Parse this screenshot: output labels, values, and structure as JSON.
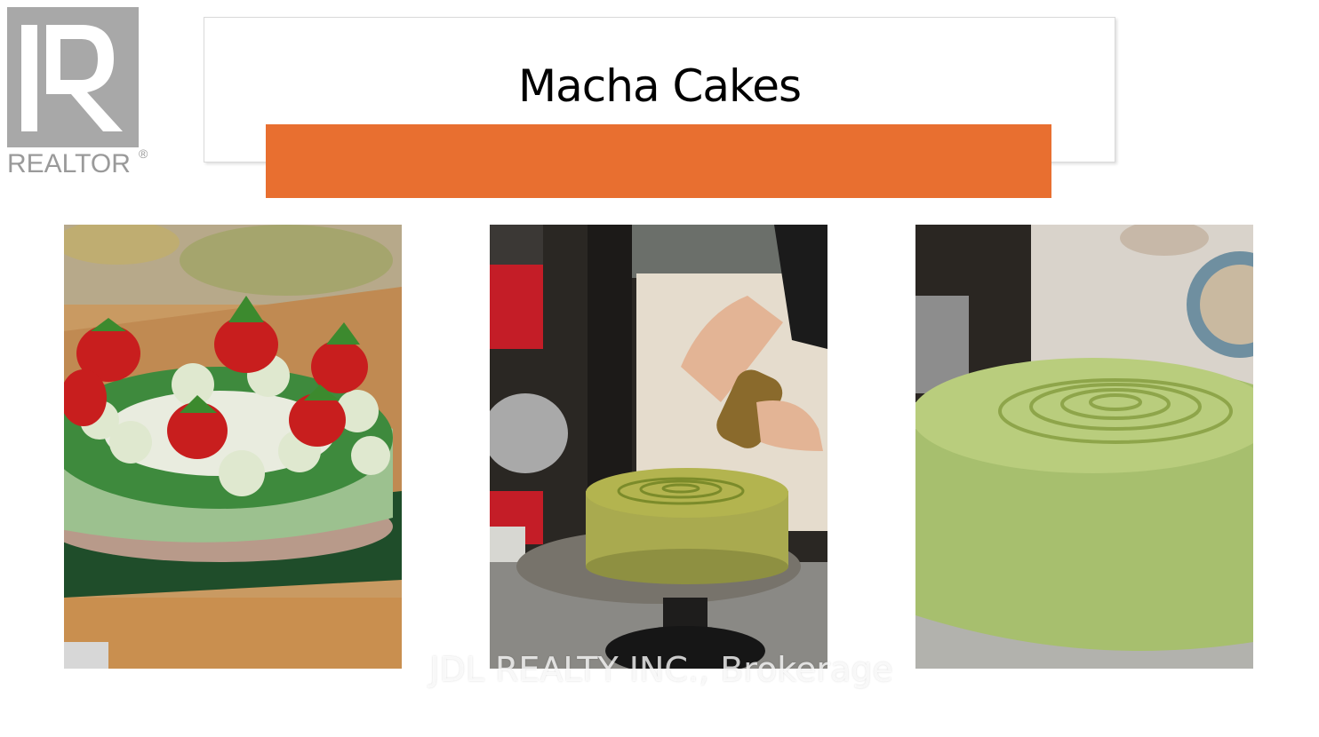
{
  "logo": {
    "text": "REALTOR",
    "mark": "®"
  },
  "header": {
    "title": "Macha Cakes",
    "accent_color": "#e86f30"
  },
  "photos": [
    {
      "name": "strawberry-matcha-cheesecake"
    },
    {
      "name": "dusting-matcha-cake"
    },
    {
      "name": "matcha-cake-closeup"
    }
  ],
  "watermark": "JDL REALTY INC., Brokerage"
}
